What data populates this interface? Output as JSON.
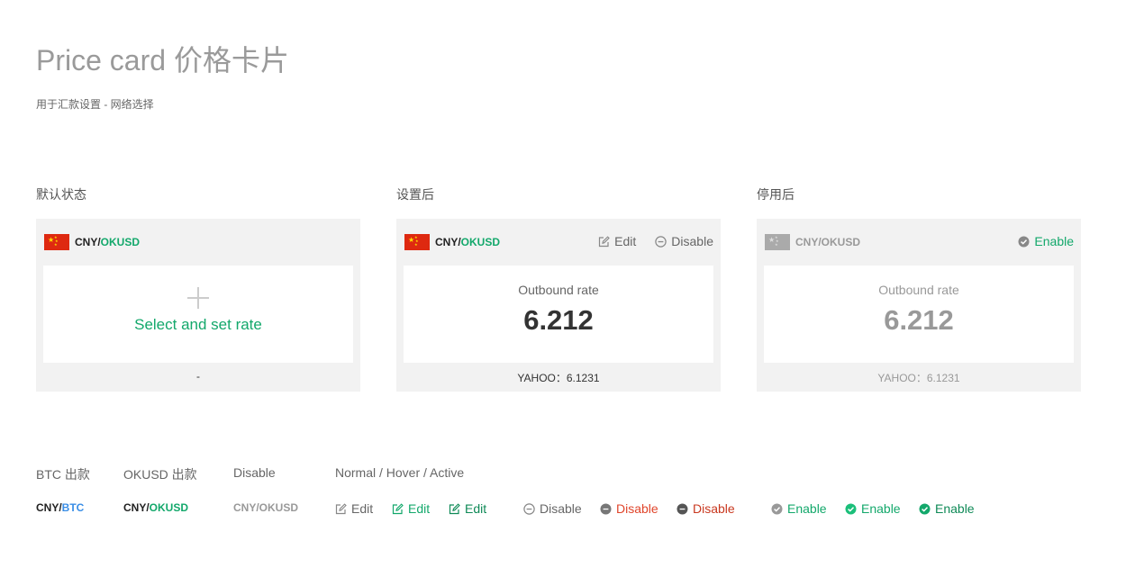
{
  "header": {
    "title": "Price card 价格卡片",
    "subtitle": "用于汇款设置 - 网络选择"
  },
  "sections": {
    "default": "默认状态",
    "configured": "设置后",
    "disabled": "停用后"
  },
  "card_default": {
    "pair_base": "CNY/",
    "pair_quote": "OKUSD",
    "cta": "Select and set rate",
    "footer": "-"
  },
  "card_configured": {
    "pair_base": "CNY/",
    "pair_quote": "OKUSD",
    "edit_label": "Edit",
    "disable_label": "Disable",
    "rate_label": "Outbound rate",
    "rate_value": "6.212",
    "footer": "YAHOO：6.1231"
  },
  "card_disabled": {
    "pair": "CNY/OKUSD",
    "enable_label": "Enable",
    "rate_label": "Outbound rate",
    "rate_value": "6.212",
    "footer": "YAHOO：6.1231"
  },
  "legend": {
    "btc_out": "BTC 出款",
    "okusd_out": "OKUSD 出款",
    "disable": "Disable",
    "states": "Normal / Hover / Active"
  },
  "samples": {
    "btc_base": "CNY/",
    "btc_quote": "BTC",
    "okusd_base": "CNY/",
    "okusd_quote": "OKUSD",
    "disabled_pair": "CNY/OKUSD",
    "edit": [
      "Edit",
      "Edit",
      "Edit"
    ],
    "disable": [
      "Disable",
      "Disable",
      "Disable"
    ],
    "enable": [
      "Enable",
      "Enable",
      "Enable"
    ]
  },
  "colors": {
    "accent_green": "#13a86b",
    "btc_blue": "#3a8ee6",
    "danger_red": "#e0452b",
    "card_bg": "#f2f2f2",
    "flag_red": "#de2910"
  },
  "icons": {
    "flag": "china-flag-icon",
    "edit": "edit-icon",
    "disable": "minus-circle-icon",
    "enable": "check-circle-icon",
    "add": "plus-icon"
  }
}
